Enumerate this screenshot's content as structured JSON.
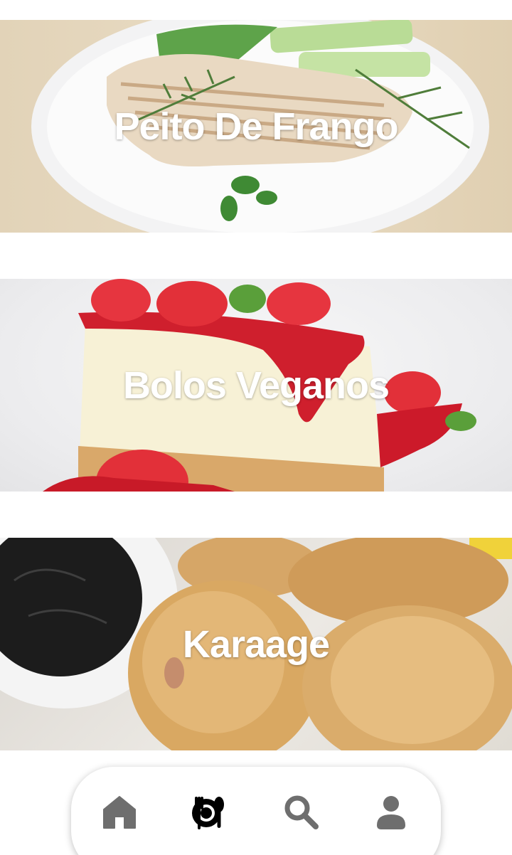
{
  "recipes": [
    {
      "title": "Peito De Frango",
      "image": "grilled-chicken-plate"
    },
    {
      "title": "Bolos Veganos",
      "image": "strawberry-cheesecake"
    },
    {
      "title": "Karaage",
      "image": "fried-chicken-with-sauce"
    }
  ],
  "bottom_nav": {
    "items": [
      {
        "icon": "home-icon",
        "active": false
      },
      {
        "icon": "cutlery-plate-icon",
        "active": true
      },
      {
        "icon": "search-icon",
        "active": false
      },
      {
        "icon": "user-icon",
        "active": false
      }
    ],
    "colors": {
      "active": "#000000",
      "inactive": "#6e6e6e"
    }
  }
}
